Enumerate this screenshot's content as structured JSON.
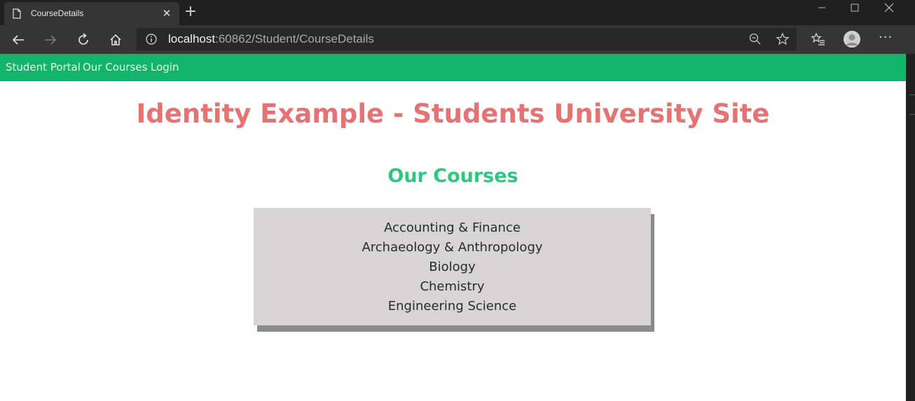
{
  "browser": {
    "tab_title": "CourseDetails",
    "url_host": "localhost",
    "url_rest": ":60862/Student/CourseDetails"
  },
  "navbar": {
    "items": [
      {
        "label": "Student Portal"
      },
      {
        "label": "Our Courses"
      },
      {
        "label": "Login"
      }
    ],
    "color": "#12b36a"
  },
  "page": {
    "title": "Identity Example - Students University Site",
    "title_color": "#e57373",
    "section_title": "Our Courses",
    "section_color": "#2fc77d",
    "courses": [
      "Accounting & Finance",
      "Archaeology & Anthropology",
      "Biology",
      "Chemistry",
      "Engineering Science"
    ]
  },
  "icons": [
    "page-icon",
    "close-icon",
    "plus-icon",
    "minimize-icon",
    "maximize-icon",
    "back-icon",
    "forward-icon",
    "refresh-icon",
    "home-icon",
    "info-icon",
    "zoom-out-icon",
    "star-icon",
    "favorites-icon",
    "profile-icon",
    "more-icon"
  ]
}
